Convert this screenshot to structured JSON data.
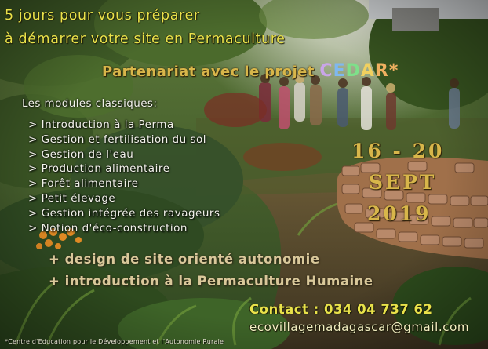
{
  "title": {
    "line1": "5 jours pour vous préparer",
    "line2": "à démarrer votre site en Permaculture"
  },
  "partner": {
    "prefix": "Partenariat avec le projet",
    "letters": [
      "C",
      "E",
      "D",
      "A",
      "R"
    ],
    "letter_colors": [
      "#c9a5e8",
      "#7fb8f0",
      "#7ee08a",
      "#f0d060",
      "#f0b060"
    ],
    "suffix": "*"
  },
  "modules": {
    "heading": "Les modules classiques:",
    "items": [
      "> Introduction à la Perma",
      "> Gestion et fertilisation du sol",
      "> Gestion de l'eau",
      "> Production alimentaire",
      "> Forêt alimentaire",
      "> Petit élevage",
      "> Gestion intégrée des ravageurs",
      "> Notion d'éco-construction"
    ]
  },
  "dates": {
    "days": "16 - 20",
    "month": "SEPT",
    "year": "2019"
  },
  "extras": [
    "+ design de site orienté autonomie",
    "+ introduction à la Permaculture Humaine"
  ],
  "contact": {
    "phone_line": "Contact : 034 04 737 62",
    "email": "ecovillagemadagascar@gmail.com"
  },
  "footer": "*Centre d'Education pour le Développement et l'Autonomie Rurale",
  "colors": {
    "title": "#e9e24a",
    "body_text": "#f2f2ea",
    "date": "#d8b64a",
    "extras": "#d9c89a",
    "email": "#f3efc2"
  }
}
